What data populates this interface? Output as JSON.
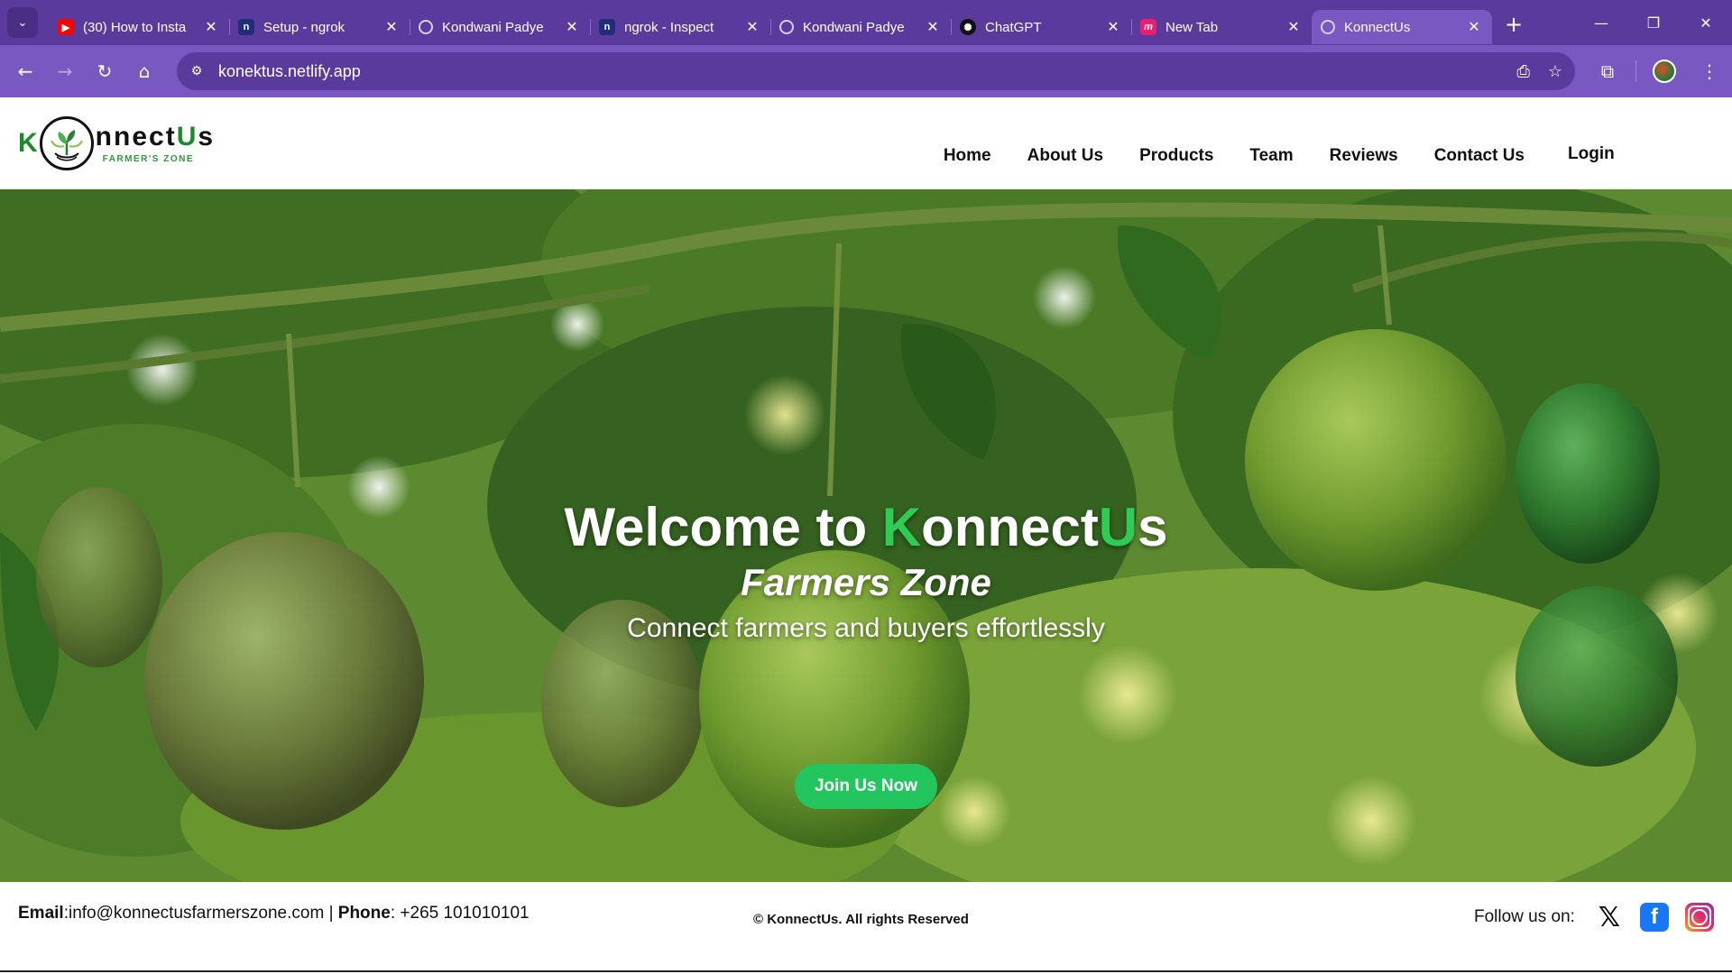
{
  "browser": {
    "tabs": [
      {
        "title": "(30) How to Insta",
        "favicon": "youtube-icon"
      },
      {
        "title": "Setup - ngrok",
        "favicon": "ngrok-icon"
      },
      {
        "title": "Kondwani Padye",
        "favicon": "globe-icon"
      },
      {
        "title": "ngrok - Inspect",
        "favicon": "ngrok-icon"
      },
      {
        "title": "Kondwani Padye",
        "favicon": "globe-icon"
      },
      {
        "title": "ChatGPT",
        "favicon": "chatgpt-icon"
      },
      {
        "title": "New Tab",
        "favicon": "m-icon"
      },
      {
        "title": "KonnectUs",
        "favicon": "globe-icon"
      }
    ],
    "active_tab": 7,
    "url": "konektus.netlify.app",
    "colors": {
      "frame": "#5b3a9e",
      "toolbar": "#7a58c2"
    }
  },
  "site": {
    "logo": {
      "k": "K",
      "word_a": "nnect",
      "word_b": "U",
      "word_c": "s",
      "sub": "FARMER'S ZONE"
    },
    "nav": [
      "Home",
      "About Us",
      "Products",
      "Team",
      "Reviews",
      "Contact Us"
    ],
    "login": "Login",
    "hero": {
      "title_a": "Welcome to ",
      "title_k": "K",
      "title_b": "onnect",
      "title_u": "U",
      "title_c": "s",
      "subtitle": "Farmers Zone",
      "tagline": "Connect farmers and buyers effortlessly",
      "cta": "Join Us Now"
    },
    "footer": {
      "email_label": "Email",
      "email": ":info@konnectusfarmerszone.com | ",
      "phone_label": "Phone",
      "phone": ": +265 101010101",
      "copyright": "© KonnectUs. All rights Reserved",
      "follow": "Follow us on:",
      "social": [
        "x-icon",
        "facebook-icon",
        "instagram-icon"
      ]
    },
    "colors": {
      "accent": "#22c55e",
      "brand_green": "#1a8a2c"
    }
  }
}
